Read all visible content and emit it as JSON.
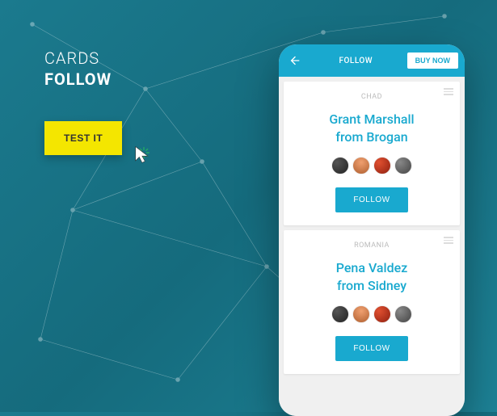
{
  "left": {
    "line1": "CARDS",
    "line2": "FOLLOW",
    "cta": "TEST IT"
  },
  "phone": {
    "header_title": "FOLLOW",
    "buy_now": "BUY NOW"
  },
  "cards": [
    {
      "country": "CHAD",
      "name_line1": "Grant Marshall",
      "name_line2": "from Brogan",
      "follow": "FOLLOW"
    },
    {
      "country": "ROMANIA",
      "name_line1": "Pena Valdez",
      "name_line2": "from Sidney",
      "follow": "FOLLOW"
    }
  ]
}
